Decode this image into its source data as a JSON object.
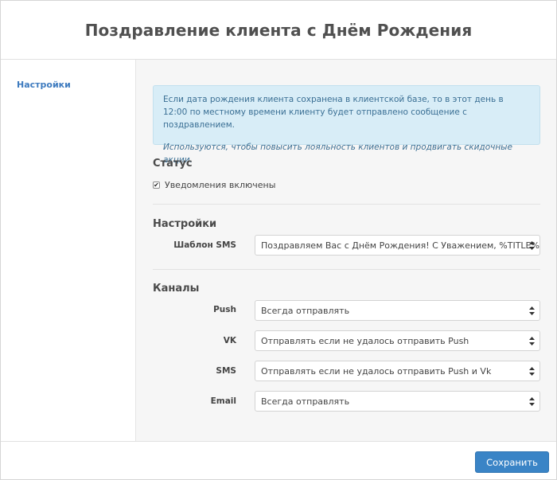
{
  "header": {
    "title": "Поздравление клиента с Днём Рождения"
  },
  "sidebar": {
    "items": [
      {
        "label": "Настройки",
        "active": true
      }
    ]
  },
  "info": {
    "text": "Если дата рождения клиента сохранена в клиентской базе, то в этот день в 12:00 по местному времени клиенту будет отправлено сообщение с поздравлением.",
    "note": "Используются, чтобы повысить лояльность клиентов и продвигать скидочные акции."
  },
  "status": {
    "title": "Статус",
    "notifications_label": "Уведомления включены",
    "notifications_checked": true
  },
  "settings": {
    "title": "Настройки",
    "sms_template_label": "Шаблон SMS",
    "sms_template_value": "Поздравляем Вас с Днём Рождения! С Уважением, %TITLE%"
  },
  "channels": {
    "title": "Каналы",
    "push": {
      "label": "Push",
      "value": "Всегда отправлять"
    },
    "vk": {
      "label": "VK",
      "value": "Отправлять если не удалось отправить Push"
    },
    "sms": {
      "label": "SMS",
      "value": "Отправлять если не удалось отправить Push и Vk"
    },
    "email": {
      "label": "Email",
      "value": "Всегда отправлять"
    }
  },
  "footer": {
    "save_label": "Сохранить"
  },
  "colors": {
    "accent": "#3a84c6",
    "link": "#3e7bbf",
    "info_bg": "#d8edf7",
    "info_text": "#3a6f94"
  },
  "icons": {
    "select_caret": "updown-caret-icon",
    "checkbox": "checkmark-icon"
  }
}
